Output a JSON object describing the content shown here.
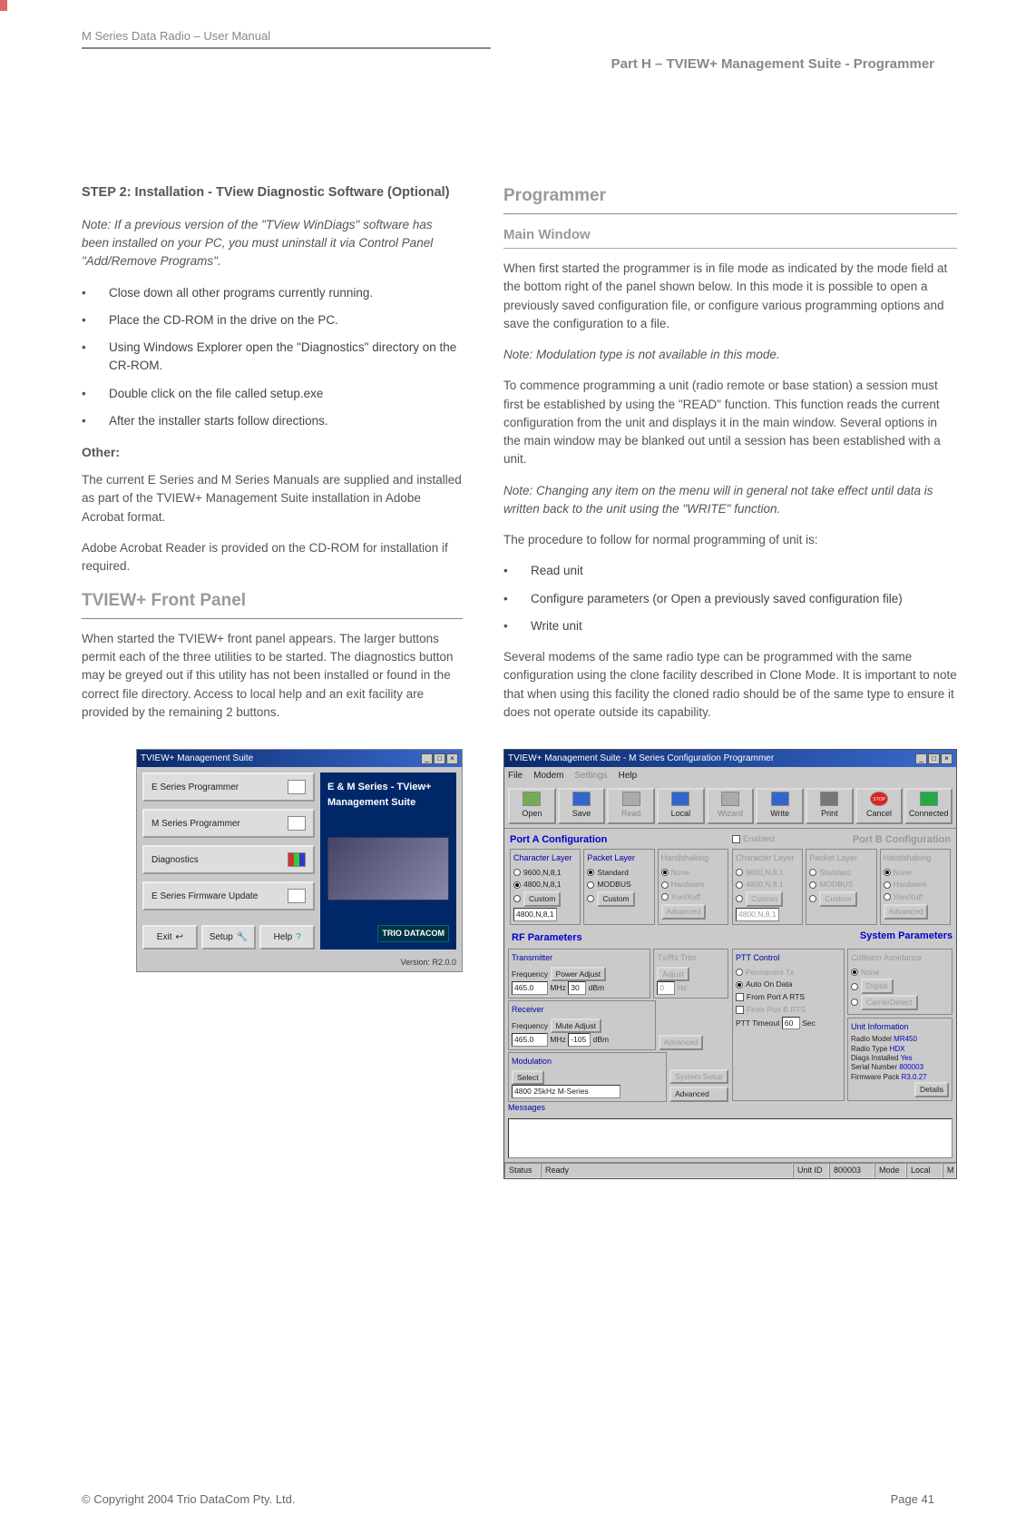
{
  "header": {
    "left": "M Series Data Radio – User Manual",
    "right": "Part H – TVIEW+ Management Suite - Programmer"
  },
  "leftCol": {
    "step2Heading": "STEP 2: Installation - TView Diagnostic Software (Optional)",
    "step2Note": "Note: If a previous version of the \"TView WinDiags\" software has been installed on your PC, you must uninstall it via Control Panel \"Add/Remove Programs\".",
    "step2Bullets": [
      "Close down all other programs currently running.",
      "Place the CD-ROM in the drive on the PC.",
      "Using Windows Explorer open the \"Diagnostics\" directory on the CR-ROM.",
      "Double click on the file called setup.exe",
      "After the installer starts follow directions."
    ],
    "otherHeading": "Other:",
    "otherP1": "The current E Series and M Series Manuals are supplied and installed as part of the TVIEW+ Management Suite installation in Adobe Acrobat format.",
    "otherP2": "Adobe Acrobat Reader is provided on the CD-ROM for installation if required.",
    "frontPanelHeading": "TVIEW+ Front Panel",
    "frontPanelP": "When started the TVIEW+ front panel appears. The larger buttons permit each of the three utilities to be started. The diagnostics button may be greyed out if this utility has not been installed or found in the correct file directory.  Access to local help and an exit facility are provided by the remaining 2 buttons."
  },
  "rightCol": {
    "programmerHeading": "Programmer",
    "mainWindowHeading": "Main Window",
    "mwP1": "When first started the programmer is in file mode as indicated by the mode field at the bottom right of the panel shown below. In this mode it is possible to open a previously saved configuration file, or configure various programming options and save the configuration to a file.",
    "mwNote1": "Note: Modulation type is not available in this mode.",
    "mwP2": "To commence programming a unit (radio remote or base station) a session must first be established by using the \"READ\" function. This function reads the current configuration from the unit and displays it in the main window. Several options in the main window may be blanked out until a session has been established with a unit.",
    "mwNote2": "Note: Changing any item on the menu will in general not take effect until data is written back to the unit using the \"WRITE\" function.",
    "mwP3": "The procedure to follow for normal programming of unit is:",
    "mwBullets": [
      "Read unit",
      "Configure parameters (or Open a previously saved configuration file)",
      "Write unit"
    ],
    "mwP4": "Several modems of the same radio type can be programmed with the same configuration using the clone facility described in Clone Mode. It is important to note that when using this facility the cloned radio should be of the same type to ensure it does not operate outside its capability."
  },
  "shot1": {
    "title": "TVIEW+ Management Suite",
    "buttons": [
      "E Series Programmer",
      "M Series Programmer",
      "Diagnostics",
      "E Series Firmware Update"
    ],
    "bottom": [
      "Exit",
      "Setup",
      "Help"
    ],
    "brand": "E & M Series - TView+ Management Suite",
    "logo": "TRIO DATACOM",
    "version": "Version: R2.0.0"
  },
  "shot2": {
    "title": "TVIEW+ Management Suite - M Series Configuration Programmer",
    "menu": [
      "File",
      "Modem",
      "Settings",
      "Help"
    ],
    "toolbar": [
      {
        "label": "Open",
        "disabled": false,
        "color": "#7a5"
      },
      {
        "label": "Save",
        "disabled": false,
        "color": "#36c"
      },
      {
        "label": "Read",
        "disabled": true,
        "color": "#aaa"
      },
      {
        "label": "Local",
        "disabled": false,
        "color": "#36c"
      },
      {
        "label": "Wizard",
        "disabled": true,
        "color": "#aaa"
      },
      {
        "label": "Write",
        "disabled": false,
        "color": "#36c"
      },
      {
        "label": "Print",
        "disabled": false,
        "color": "#777"
      },
      {
        "label": "Cancel",
        "disabled": false,
        "color": "#d22"
      },
      {
        "label": "Connected",
        "disabled": false,
        "color": "#2a4"
      }
    ],
    "portA": {
      "title": "Port A Configuration",
      "charLayer": {
        "title": "Character Layer",
        "opts": [
          "9600,N,8,1",
          "4800,N,8,1",
          "Custom"
        ],
        "sel": 1,
        "custom": "4800,N,8,1"
      },
      "packetLayer": {
        "title": "Packet Layer",
        "opts": [
          "Standard",
          "MODBUS",
          "Custom"
        ],
        "sel": 0
      },
      "handshaking": {
        "title": "Handshaking",
        "opts": [
          "None",
          "Hardware",
          "Xon/Xoff"
        ],
        "sel": 0,
        "btn": "Advanced"
      }
    },
    "portB": {
      "title": "Port B Configuration",
      "charLayer": {
        "title": "Character Layer",
        "opts": [
          "9600,N,8,1",
          "4800,N,8,1",
          "Custom"
        ],
        "custom": "4800,N,8,1"
      },
      "packetLayer": {
        "title": "Packet Layer",
        "opts": [
          "Standard",
          "MODBUS",
          "Custom"
        ]
      },
      "handshaking": {
        "title": "Handshaking",
        "opts": [
          "None",
          "Hardware",
          "Xon/Xoff"
        ],
        "sel": 0,
        "btn": "Advanced"
      },
      "enabled": "Enabled"
    },
    "rf": {
      "title": "RF Parameters",
      "tx": {
        "title": "Transmitter",
        "freqLabel": "Frequency",
        "freq": "465.0",
        "mhz": "MHz",
        "powerBtn": "Power Adjust",
        "power": "30",
        "dbm": "dBm"
      },
      "txrx": {
        "title": "Tx/Rx Trim",
        "btn": "Adjust",
        "val": "0",
        "hz": "Hz"
      },
      "rx": {
        "title": "Receiver",
        "freqLabel": "Frequency",
        "freq": "465.0",
        "mhz": "MHz",
        "muteBtn": "Mute Adjust",
        "mute": "-105",
        "dbm": "dBm",
        "advBtn": "Advanced"
      },
      "mod": {
        "title": "Modulation",
        "selectBtn": "Select",
        "val": "4800 25kHz M-Series",
        "sysBtn": "System Setup",
        "advBtn": "Advanced"
      }
    },
    "sys": {
      "title": "System Parameters",
      "ptt": {
        "title": "PTT Control",
        "opts": [
          "Permanent Tx",
          "Auto On Data",
          "From Port A RTS",
          "From Port B RTS"
        ],
        "sel": 1,
        "timeoutLabel": "PTT Timeout",
        "timeout": "60",
        "sec": "Sec"
      },
      "coll": {
        "title": "Collision Avoidance",
        "opts": [
          "None",
          "Digital",
          "CarrierDetect"
        ]
      },
      "unit": {
        "title": "Unit Information",
        "rows": [
          [
            "Radio Model",
            "MR450"
          ],
          [
            "Radio Type",
            "HDX"
          ],
          [
            "Diags Installed",
            "Yes"
          ],
          [
            "Serial Number",
            "800003"
          ],
          [
            "Firmware Pack",
            "R3.0.27"
          ]
        ],
        "btn": "Details"
      }
    },
    "messagesLabel": "Messages",
    "status": {
      "statusLabel": "Status",
      "ready": "Ready",
      "unitIdLabel": "Unit ID",
      "unitId": "800003",
      "modeLabel": "Mode",
      "mode": "Local",
      "m": "M"
    }
  },
  "footer": {
    "copyright": "© Copyright 2004 Trio DataCom Pty. Ltd.",
    "page": "Page 41"
  }
}
